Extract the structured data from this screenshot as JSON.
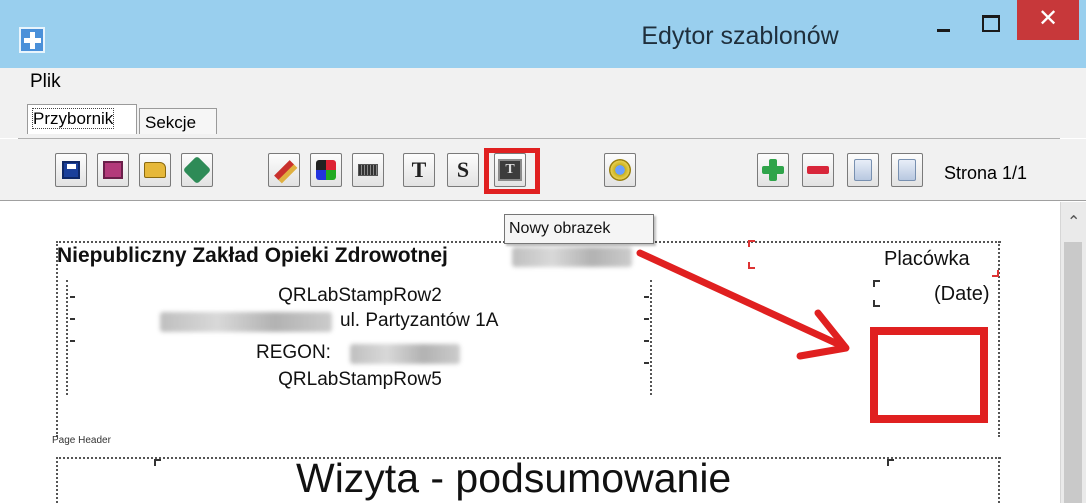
{
  "window": {
    "title": "Edytor szablonów"
  },
  "menu": {
    "items": [
      "Plik"
    ]
  },
  "tabs": [
    {
      "label": "Przybornik",
      "active": true
    },
    {
      "label": "Sekcje",
      "active": false
    }
  ],
  "toolbar": {
    "buttons": [
      "save-icon",
      "save-as-icon",
      "open-folder-icon",
      "clean-icon",
      "brush-icon",
      "colors-icon",
      "barcode-icon",
      "text-icon",
      "special-text-icon",
      "image-icon",
      "preview-icon",
      "add-page-icon",
      "remove-page-icon",
      "page-icon",
      "page-icon"
    ],
    "text_button_label": "T",
    "special_text_button_label": "S",
    "image_button_glyph": "T",
    "page_label": "Strona 1/1"
  },
  "tooltip": {
    "text": "Nowy obrazek"
  },
  "canvas": {
    "header_title": "Niepubliczny Zakład Opieki Zdrowotnej",
    "rows": [
      "QRLabStampRow2",
      "ul. Partyzantów 1A",
      "REGON:",
      "QRLabStampRow5"
    ],
    "placowka": "Placówka",
    "date": "(Date)",
    "page_header_label": "Page Header",
    "big_title": "Wizyta - podsumowanie"
  },
  "colors": {
    "titlebar": "#99cfee",
    "close_button": "#c7383a",
    "annotation_red": "#e02020"
  }
}
